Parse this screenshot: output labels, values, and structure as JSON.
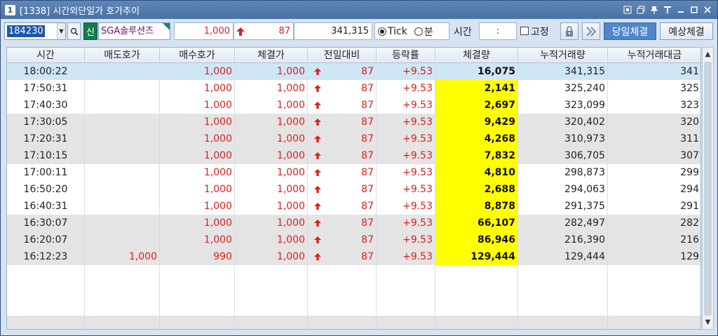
{
  "window": {
    "number": "1",
    "title": "[1338] 시간외단일가 호가추이",
    "controls": [
      "⊡",
      "⧉",
      "📌",
      "T",
      "—",
      "☐",
      "✕"
    ]
  },
  "toolbar": {
    "code": "184230",
    "badge": "신",
    "name": "SGA솔루션즈",
    "price": "1,000",
    "change": "87",
    "volume": "341,315",
    "radio_tick": "Tick",
    "radio_min": "분",
    "time_label": "시간",
    "time_value": ":",
    "fix_label": "고정",
    "today_btn": "당일체결",
    "expected_btn": "예상체결"
  },
  "table": {
    "headers": [
      "시간",
      "매도호가",
      "매수호가",
      "체결가",
      "전일대비",
      "등락률",
      "체결량",
      "누적거래량",
      "누적거래대금"
    ],
    "rows": [
      {
        "time": "18:00:22",
        "ask": "",
        "bid": "1,000",
        "price": "1,000",
        "change": "87",
        "rate": "+9.53",
        "vol": "16,075",
        "cum_vol": "341,315",
        "cum_amt": "341",
        "hl": false
      },
      {
        "time": "17:50:31",
        "ask": "",
        "bid": "1,000",
        "price": "1,000",
        "change": "87",
        "rate": "+9.53",
        "vol": "2,141",
        "cum_vol": "325,240",
        "cum_amt": "325",
        "hl": true
      },
      {
        "time": "17:40:30",
        "ask": "",
        "bid": "1,000",
        "price": "1,000",
        "change": "87",
        "rate": "+9.53",
        "vol": "2,697",
        "cum_vol": "323,099",
        "cum_amt": "323",
        "hl": true
      },
      {
        "time": "17:30:05",
        "ask": "",
        "bid": "1,000",
        "price": "1,000",
        "change": "87",
        "rate": "+9.53",
        "vol": "9,429",
        "cum_vol": "320,402",
        "cum_amt": "320",
        "hl": true
      },
      {
        "time": "17:20:31",
        "ask": "",
        "bid": "1,000",
        "price": "1,000",
        "change": "87",
        "rate": "+9.53",
        "vol": "4,268",
        "cum_vol": "310,973",
        "cum_amt": "311",
        "hl": true
      },
      {
        "time": "17:10:15",
        "ask": "",
        "bid": "1,000",
        "price": "1,000",
        "change": "87",
        "rate": "+9.53",
        "vol": "7,832",
        "cum_vol": "306,705",
        "cum_amt": "307",
        "hl": true
      },
      {
        "time": "17:00:11",
        "ask": "",
        "bid": "1,000",
        "price": "1,000",
        "change": "87",
        "rate": "+9.53",
        "vol": "4,810",
        "cum_vol": "298,873",
        "cum_amt": "299",
        "hl": true
      },
      {
        "time": "16:50:20",
        "ask": "",
        "bid": "1,000",
        "price": "1,000",
        "change": "87",
        "rate": "+9.53",
        "vol": "2,688",
        "cum_vol": "294,063",
        "cum_amt": "294",
        "hl": true
      },
      {
        "time": "16:40:31",
        "ask": "",
        "bid": "1,000",
        "price": "1,000",
        "change": "87",
        "rate": "+9.53",
        "vol": "8,878",
        "cum_vol": "291,375",
        "cum_amt": "291",
        "hl": true
      },
      {
        "time": "16:30:07",
        "ask": "",
        "bid": "1,000",
        "price": "1,000",
        "change": "87",
        "rate": "+9.53",
        "vol": "66,107",
        "cum_vol": "282,497",
        "cum_amt": "282",
        "hl": true
      },
      {
        "time": "16:20:07",
        "ask": "",
        "bid": "1,000",
        "price": "1,000",
        "change": "87",
        "rate": "+9.53",
        "vol": "86,946",
        "cum_vol": "216,390",
        "cum_amt": "216",
        "hl": true
      },
      {
        "time": "16:12:23",
        "ask": "1,000",
        "bid": "990",
        "price": "1,000",
        "change": "87",
        "rate": "+9.53",
        "vol": "129,444",
        "cum_vol": "129,444",
        "cum_amt": "129",
        "hl": true
      }
    ]
  },
  "colors": {
    "up": "#d8211f",
    "highlight": "#ffff00",
    "selected_row": "#cfe6f5",
    "gray_row": "#e4e4e4",
    "white_row": "#ffffff"
  }
}
